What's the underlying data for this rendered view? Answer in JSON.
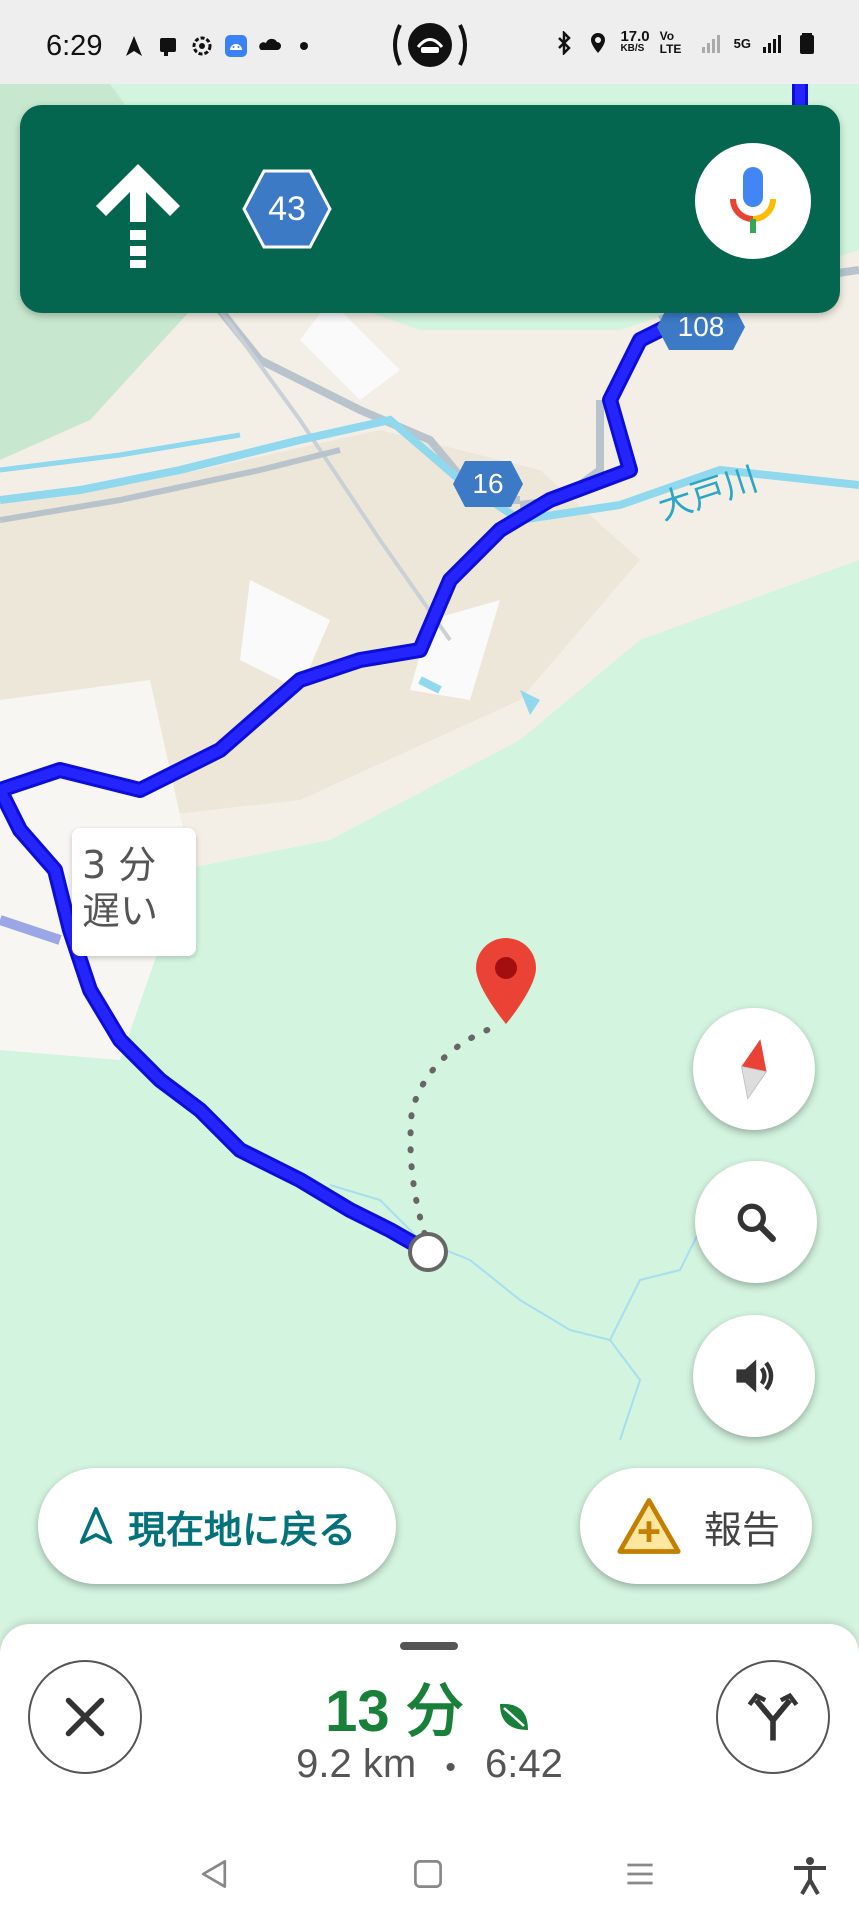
{
  "status_bar": {
    "time": "6:29",
    "net_speed_value": "17.0",
    "net_speed_unit": "KB/S",
    "volte": "Vo LTE",
    "network": "5G"
  },
  "nav_banner": {
    "route_number": "43",
    "direction": "straight",
    "mic_icon": "mic-icon",
    "background_color": "#04664f"
  },
  "map": {
    "route_shields": [
      {
        "id": "108",
        "label": "108"
      },
      {
        "id": "16",
        "label": "16"
      }
    ],
    "river_label": "大戸川",
    "delay_tag": {
      "line1": "3 分",
      "line2": "遅い"
    },
    "route_color": "#1a1aff"
  },
  "controls": {
    "compass_icon": "compass-icon",
    "search_icon": "search-icon",
    "sound_icon": "volume-icon",
    "recenter_label": "現在地に戻る",
    "report_label": "報告"
  },
  "trip": {
    "duration": "13 分",
    "distance": "9.2 km",
    "separator": "•",
    "arrival": "6:42"
  }
}
